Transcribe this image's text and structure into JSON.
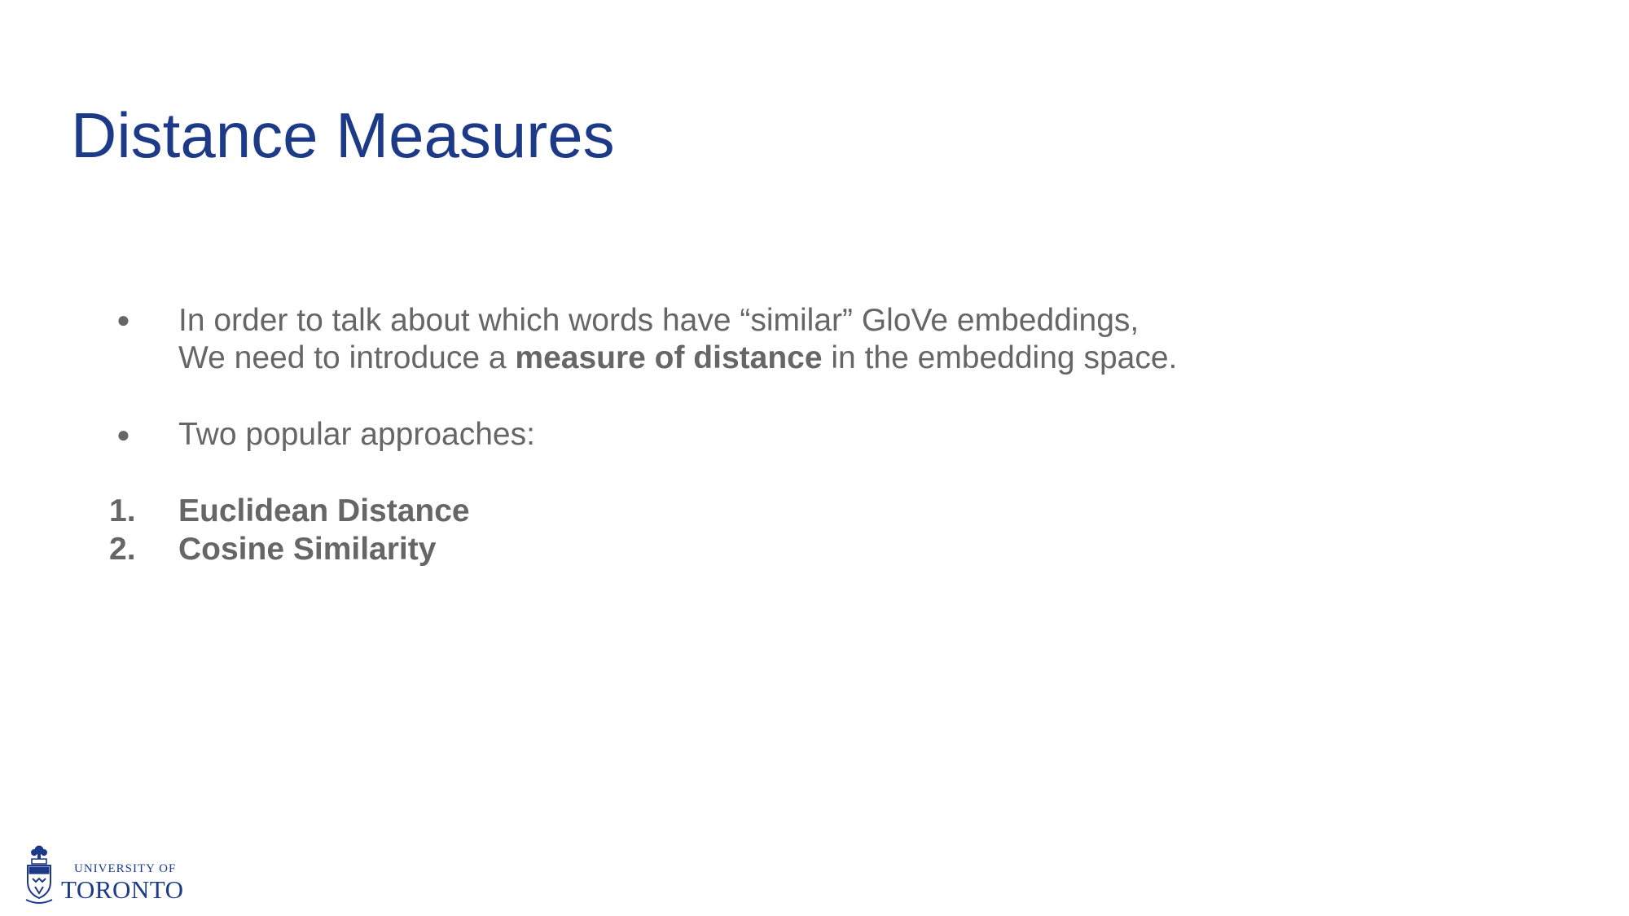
{
  "slide": {
    "title": "Distance Measures"
  },
  "bullets": [
    {
      "marker": "●",
      "line1": "In order to talk about which words have “similar” GloVe embeddings,",
      "line2_before": "We need to introduce a ",
      "line2_bold": "measure of distance",
      "line2_after": " in the embedding space."
    },
    {
      "marker": "●",
      "text": "Two popular approaches:"
    }
  ],
  "numbered": [
    {
      "marker": "1.",
      "text": "Euclidean Distance"
    },
    {
      "marker": "2.",
      "text": "Cosine Similarity"
    }
  ],
  "logo": {
    "line1": "UNIVERSITY OF",
    "line2": "TORONTO",
    "color": "#1c3a87"
  },
  "colors": {
    "title": "#1c3a87",
    "body": "#666666",
    "background": "#ffffff"
  }
}
